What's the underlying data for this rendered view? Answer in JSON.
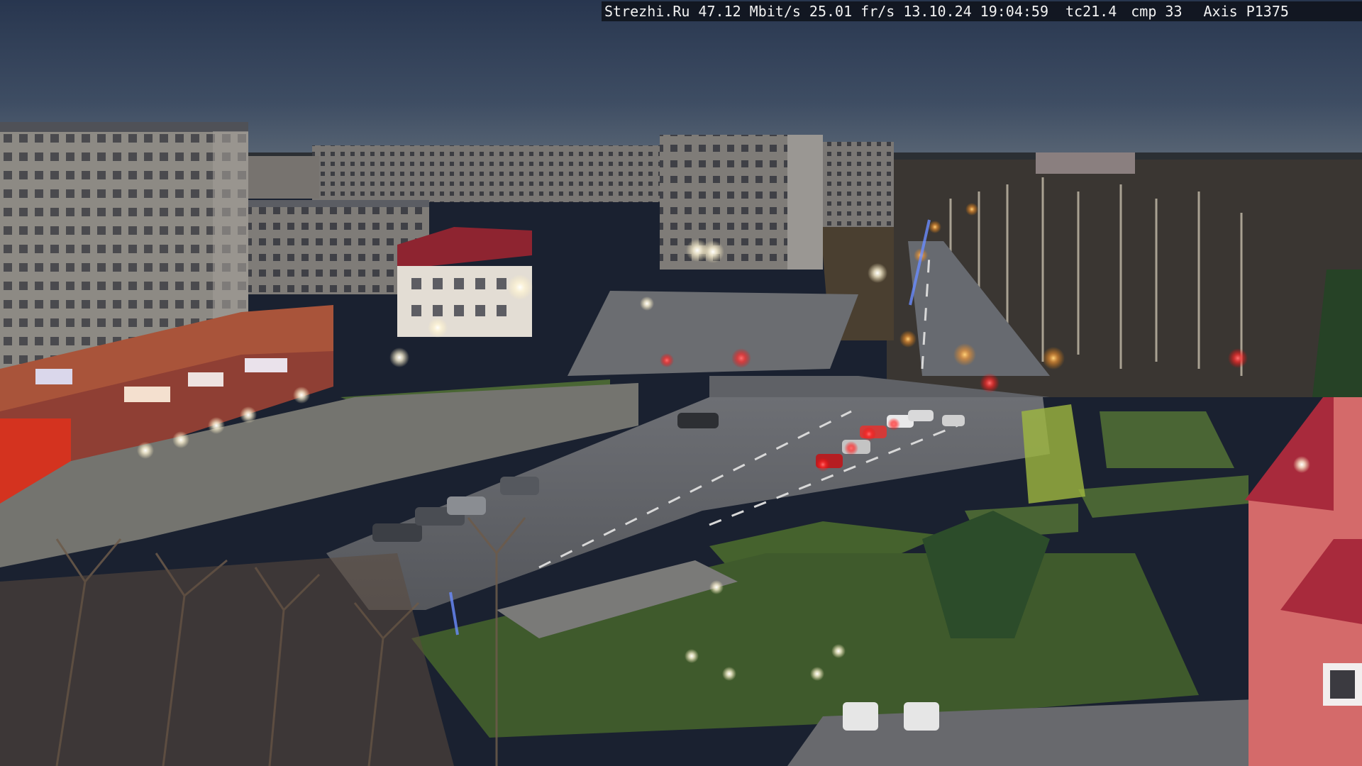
{
  "osd": {
    "site": "Strezhi.Ru",
    "bitrate": "47.12 Mbit/s",
    "framerate": "25.01 fr/s",
    "date": "13.10.24",
    "time": "19:04:59",
    "tc": "tc21.4",
    "cmp": "cmp 33",
    "camera": "Axis P1375"
  },
  "scene": {
    "type": "webcam-photo",
    "subject": "city-square-dusk",
    "colors": {
      "sky_top": "#2a3a55",
      "sky_bottom": "#55657a",
      "road": "#5b5d62",
      "grass": "#3f5a2c",
      "building_panel": "#8c8a86",
      "building_brick": "#a94a35",
      "roof_red": "#a52236",
      "tail_light": "#ff3b3b",
      "street_lamp": "#fff4d0"
    }
  }
}
